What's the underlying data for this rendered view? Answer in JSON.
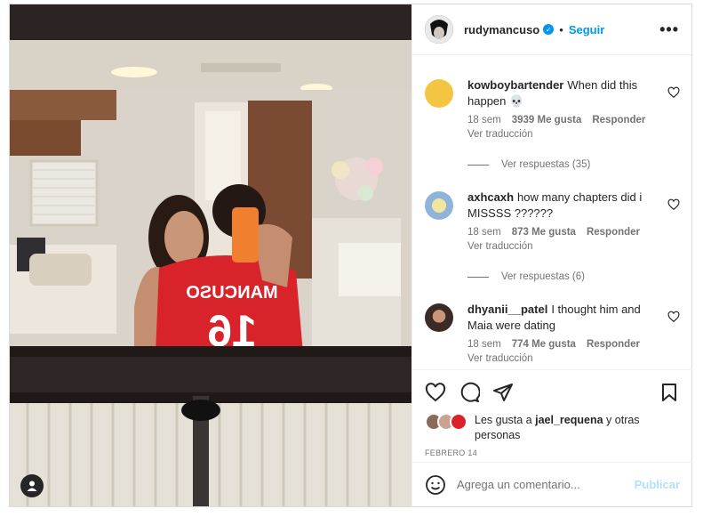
{
  "post": {
    "username": "rudymancuso",
    "follow_label": "Seguir",
    "dot": "•",
    "more_label": "•••",
    "jersey_name": "MANCUSO",
    "jersey_number": "16"
  },
  "comments": [
    {
      "username": "kowboybartender",
      "text": "When did this happen 💀",
      "time": "18 sem",
      "likes": "3939 Me gusta",
      "reply_label": "Responder",
      "translate_label": "Ver traducción",
      "view_replies": "Ver respuestas (35)",
      "avatar_color": "#f4c542"
    },
    {
      "username": "axhcaxh",
      "text": "how many chapters did i MISSSS ??????",
      "time": "18 sem",
      "likes": "873 Me gusta",
      "reply_label": "Responder",
      "translate_label": "Ver traducción",
      "view_replies": "Ver respuestas (6)",
      "avatar_color": "#8fb3d9"
    },
    {
      "username": "dhyanii__patel",
      "text": "I thought him and Maia were dating",
      "time": "18 sem",
      "likes": "774 Me gusta",
      "reply_label": "Responder",
      "translate_label": "Ver traducción",
      "avatar_color": "#3a2b26"
    }
  ],
  "likes": {
    "prefix": "Les gusta a",
    "user": "jael_requena",
    "suffix": "y otras personas"
  },
  "date": "FEBRERO 14",
  "composer": {
    "placeholder": "Agrega un comentario...",
    "publish_label": "Publicar"
  },
  "colors": {
    "accent": "#0095f6",
    "publish_disabled": "#b2dffc",
    "muted": "#737373",
    "jersey_red": "#d8232a",
    "phone_orange": "#f07f2f"
  }
}
